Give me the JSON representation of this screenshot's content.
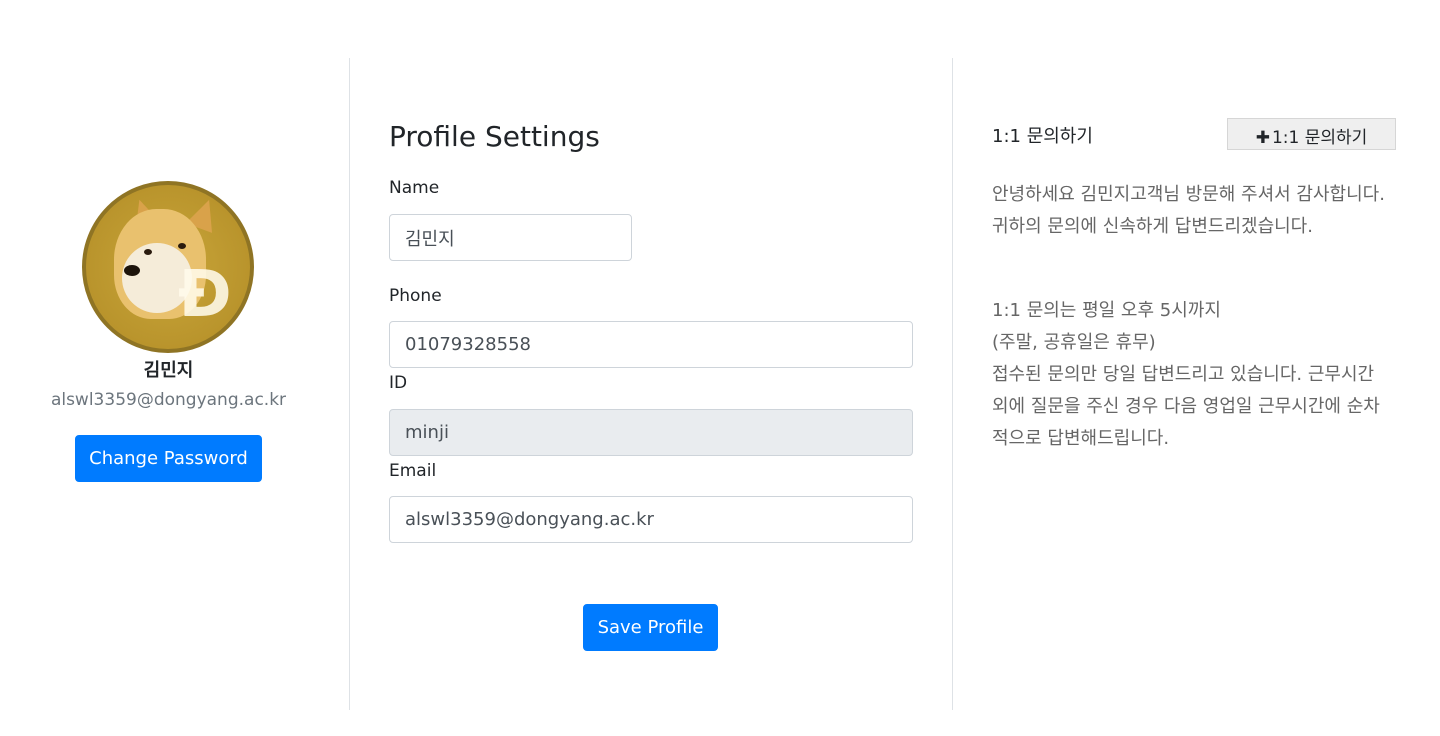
{
  "profile": {
    "display_name": "김민지",
    "email": "alswl3359@dongyang.ac.kr",
    "change_password_label": "Change Password",
    "avatar_text": "Ð"
  },
  "settings": {
    "title": "Profile Settings",
    "name_label": "Name",
    "name_value": "김민지",
    "phone_label": "Phone",
    "phone_value": "01079328558",
    "id_label": "ID",
    "id_value": "minji",
    "email_label": "Email",
    "email_value": "alswl3359@dongyang.ac.kr",
    "save_label": "Save Profile"
  },
  "inquiry": {
    "title": "1:1 문의하기",
    "button_icon": "✚",
    "button_label": "1:1 문의하기",
    "greeting_line1": "안녕하세요 김민지고객님 방문해 주셔서 감사합니다.",
    "greeting_line2": "귀하의 문의에 신속하게 답변드리겠습니다.",
    "hours_line1": "1:1 문의는 평일 오후 5시까지",
    "hours_line2": "(주말, 공휴일은 휴무)",
    "hours_line3": "접수된 문의만 당일 답변드리고 있습니다. 근무시간 외에 질문을 주신 경우 다음 영업일 근무시간에 순차적으로 답변해드립니다."
  },
  "colors": {
    "primary": "#007bff",
    "muted_text": "#6c757d",
    "readonly_bg": "#e9ecef"
  }
}
